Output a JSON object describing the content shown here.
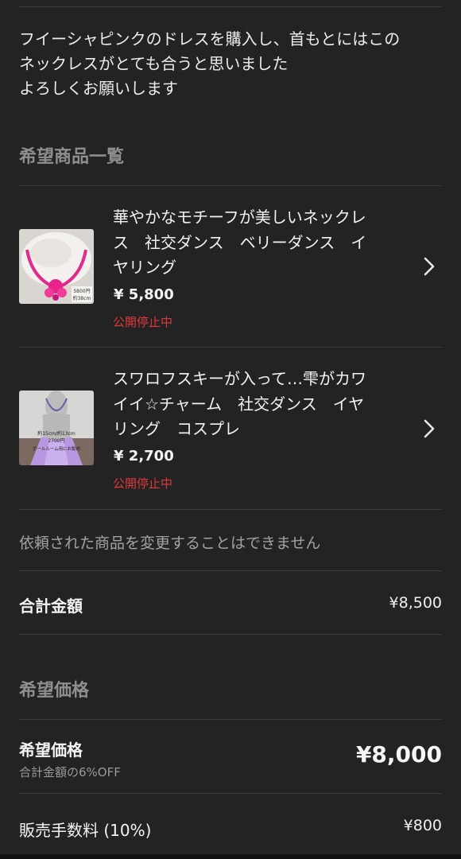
{
  "message": {
    "lines": [
      "フイーシャピンクのドレスを購入し、首もとにはこの",
      "ネックレスがとても合うと思いました",
      "よろしくお願いします"
    ]
  },
  "wish_list": {
    "title": "希望商品一覧",
    "items": [
      {
        "title_lines": [
          "華やかなモチーフが美しいネックレ",
          "ス　社交ダンス　ベリーダンス　イ",
          "ヤリング"
        ],
        "price": "¥ 5,800",
        "status": "公開停止中",
        "thumb_text": [
          "5800円",
          "約38cm"
        ]
      },
      {
        "title_lines": [
          "スワロフスキーが入って…雫がカワ",
          "イイ☆チャーム　社交ダンス　イヤ",
          "リング　コスプレ"
        ],
        "price": "¥ 2,700",
        "status": "公開停止中",
        "thumb_text": [
          "約15cm/約13cm",
          "2700円",
          "ボールルーム用にお勧め"
        ]
      }
    ],
    "note": "依頼された商品を変更することはできません"
  },
  "total": {
    "label": "合計金額",
    "value": "¥8,500"
  },
  "desired_price_section": {
    "title": "希望価格",
    "label": "希望価格",
    "sub": "合計金額の6%OFF",
    "value": "¥8,000"
  },
  "fee": {
    "label": "販売手数料 (10%)",
    "value": "¥800"
  },
  "colors": {
    "background": "#232323",
    "status_red": "#e0393b"
  },
  "icons": {
    "item_chevron": "chevron-right-icon"
  }
}
